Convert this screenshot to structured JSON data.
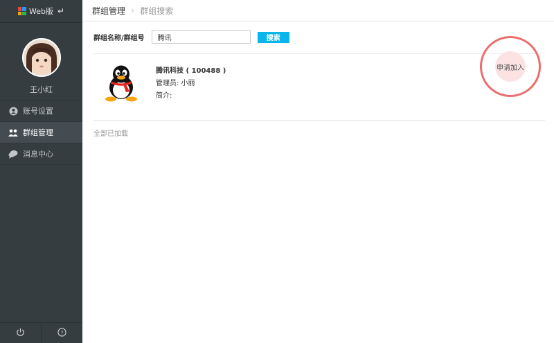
{
  "sidebar": {
    "brand_label": "Web版",
    "username": "王小红",
    "items": [
      {
        "label": "账号设置",
        "icon": "user-icon"
      },
      {
        "label": "群组管理",
        "icon": "group-icon",
        "active": true
      },
      {
        "label": "消息中心",
        "icon": "chat-icon"
      }
    ],
    "footer": {
      "power": "power-icon",
      "help": "help-icon"
    }
  },
  "breadcrumb": {
    "level1": "群组管理",
    "level2": "群组搜索"
  },
  "search": {
    "label": "群组名称/群组号",
    "value": "腾讯",
    "button": "搜索"
  },
  "result": {
    "name": "腾讯科技 ( 100488 )",
    "admin": "管理员: 小丽",
    "intro": "简介:",
    "join_label": "申请加入"
  },
  "footer_text": "全部已加载",
  "colors": {
    "sidebar_bg": "#353d41",
    "accent": "#09b5ea",
    "highlight": "#ec6d6d"
  }
}
